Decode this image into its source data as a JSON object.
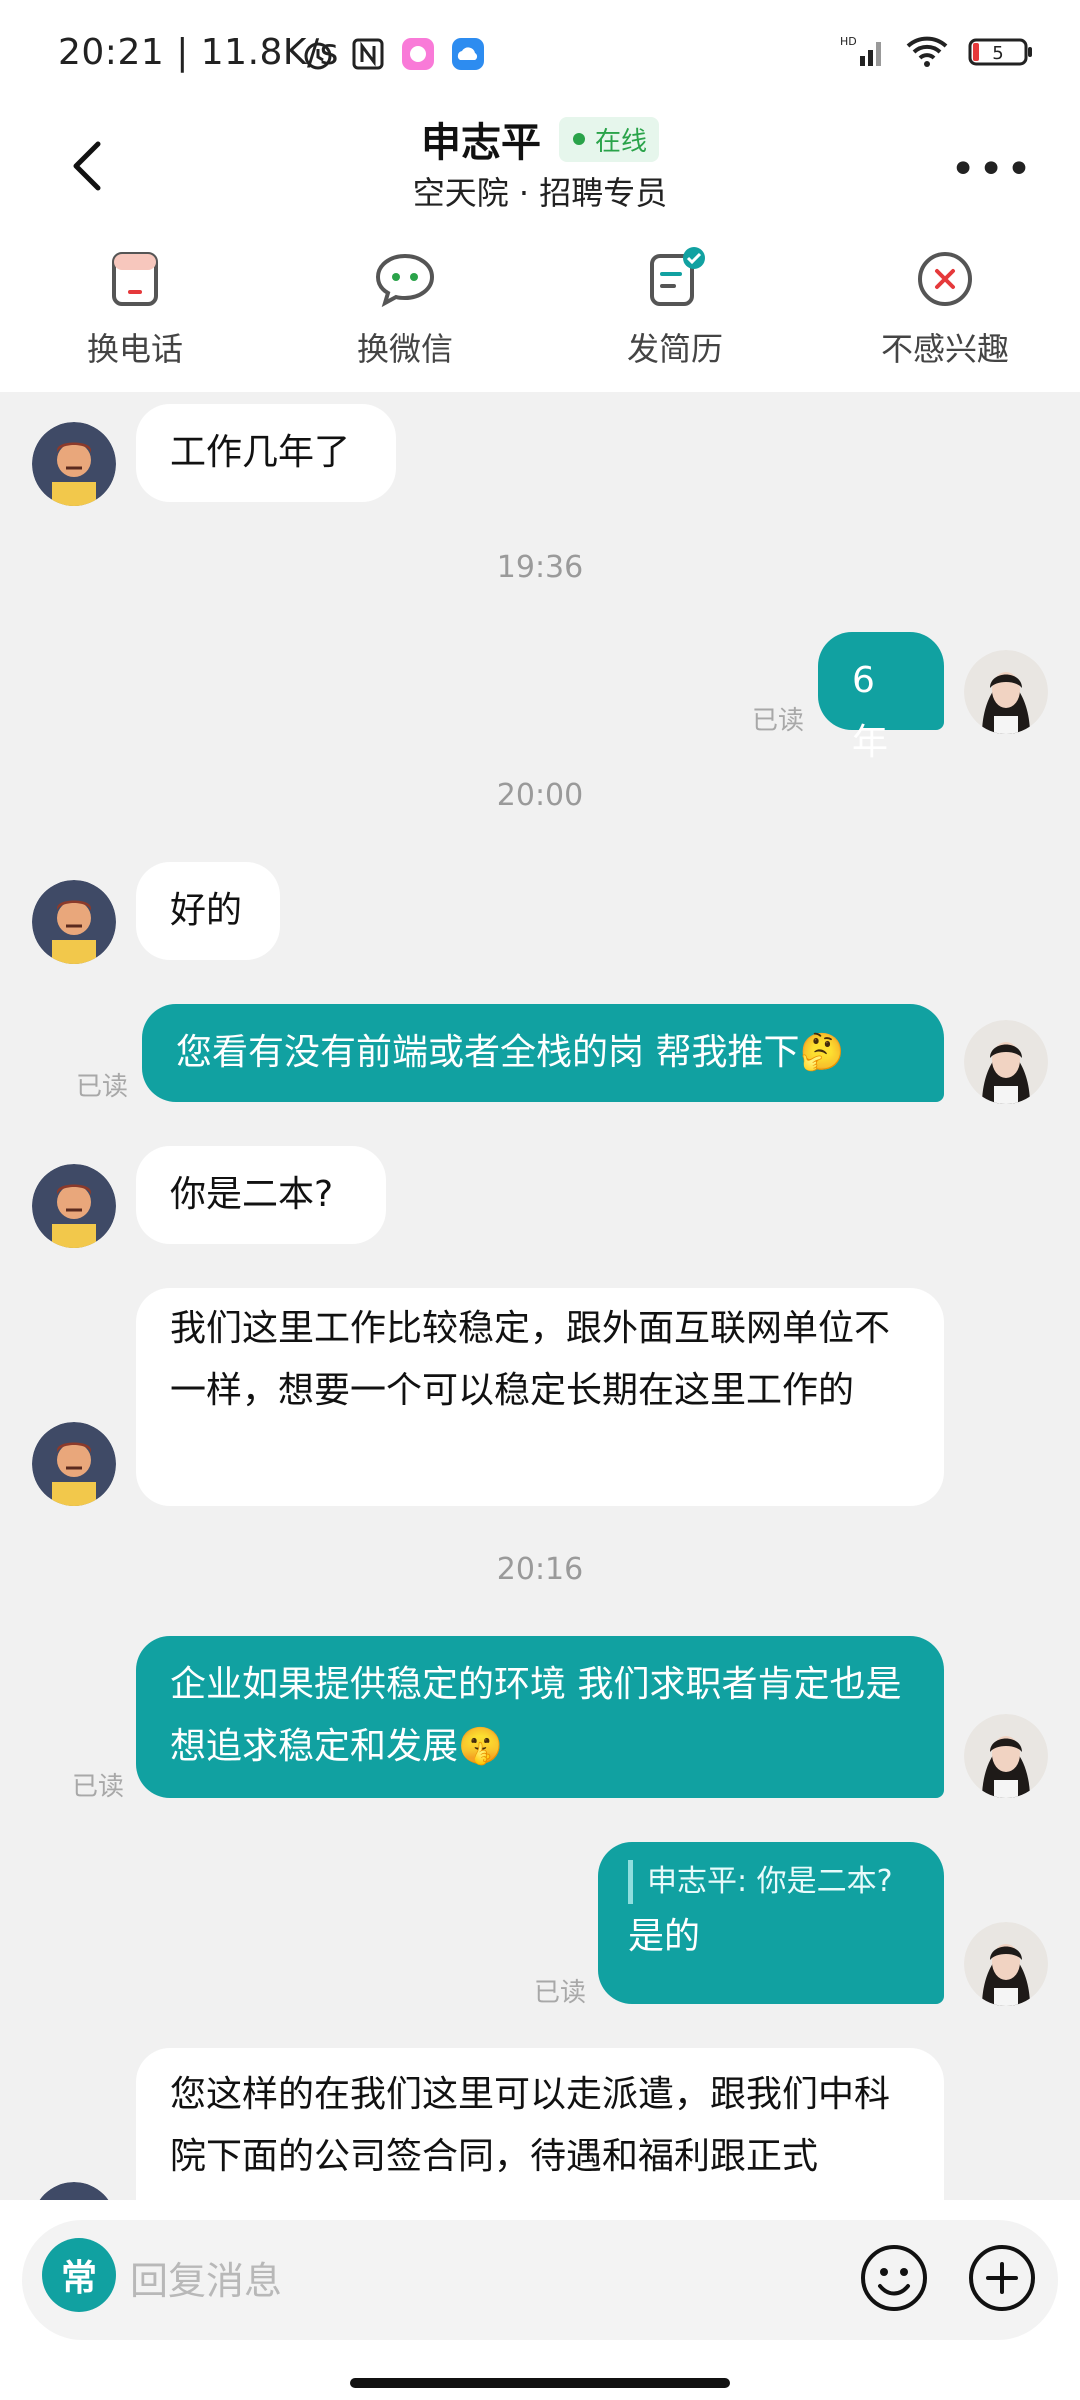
{
  "status_bar": {
    "time_speed": "20:21 | 11.8K/s",
    "battery": "5",
    "network": "HD"
  },
  "header": {
    "name": "申志平",
    "online": "在线",
    "subtitle": "空天院 · 招聘专员"
  },
  "actions": [
    {
      "label": "换电话",
      "icon": "phone-swap-icon"
    },
    {
      "label": "换微信",
      "icon": "wechat-icon"
    },
    {
      "label": "发简历",
      "icon": "resume-icon"
    },
    {
      "label": "不感兴趣",
      "icon": "not-interested-icon"
    }
  ],
  "messages": {
    "m1": "工作几年了",
    "t1": "19:36",
    "m2": "6年",
    "t2": "20:00",
    "m3": "好的",
    "m4": "您看有没有前端或者全栈的岗 帮我推下🤔",
    "m5": "你是二本?",
    "m6": "我们这里工作比较稳定，跟外面互联网单位不一样，想要一个可以稳定长期在这里工作的",
    "t3": "20:16",
    "m7": "企业如果提供稳定的环境 我们求职者肯定也是想追求稳定和发展🤫",
    "m8_quote": "申志平: 你是二本?",
    "m8": "是的",
    "m9": "您这样的在我们这里可以走派遣，跟我们中科院下面的公司签合同，待遇和福利跟正式",
    "read": "已读"
  },
  "input": {
    "chang": "常",
    "placeholder": "回复消息"
  },
  "colors": {
    "accent": "#11a1a1",
    "online": "#2aa34a",
    "close": "#e5393b"
  }
}
